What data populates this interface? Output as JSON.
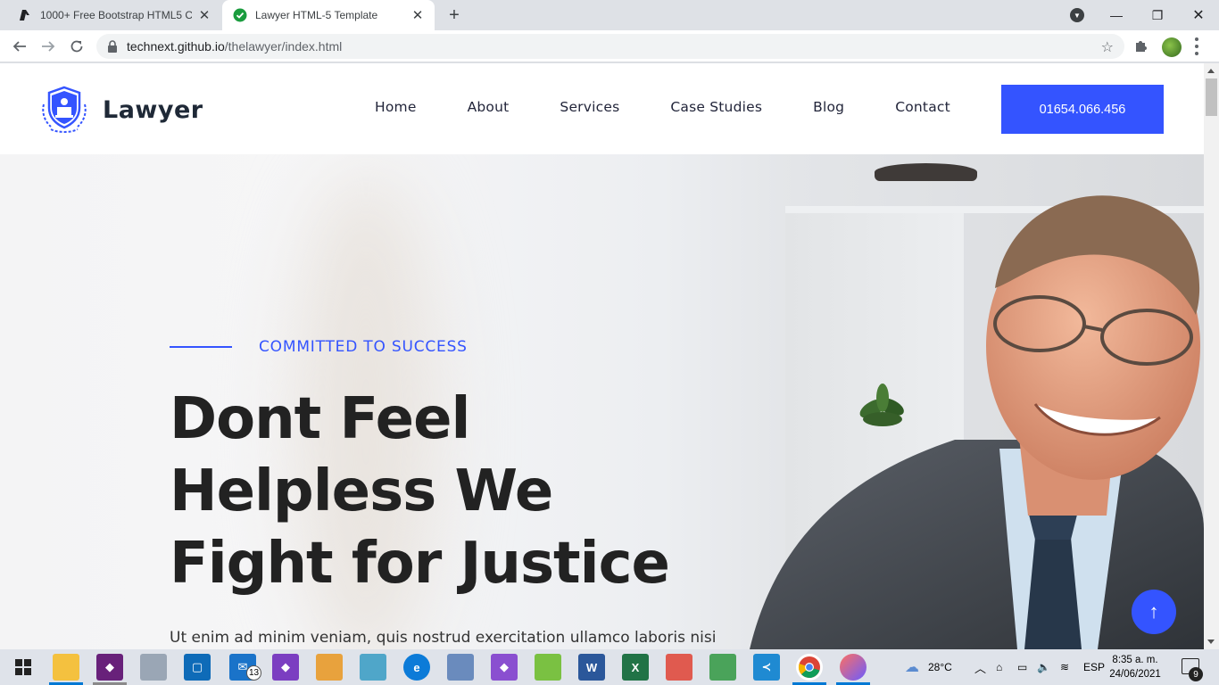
{
  "browser": {
    "tabs": [
      {
        "title": "1000+ Free Bootstrap HTML5 CS",
        "active": false
      },
      {
        "title": "Lawyer HTML-5 Template",
        "active": true
      }
    ],
    "address": {
      "host": "technext.github.io",
      "path": "/thelawyer/index.html"
    }
  },
  "site": {
    "logo_text": "Lawyer",
    "nav": [
      "Home",
      "About",
      "Services",
      "Case Studies",
      "Blog",
      "Contact"
    ],
    "phone": "01654.066.456"
  },
  "hero": {
    "kicker": "COMMITTED TO SUCCESS",
    "headline": [
      "Dont Feel",
      "Helpless We",
      "Fight for Justice"
    ],
    "lead": "Ut enim ad minim veniam, quis nostrud exercitation ullamco laboris nisi"
  },
  "taskbar": {
    "mail_badge": "13",
    "weather": "28°C",
    "language": "ESP",
    "time": "8:35 a. m.",
    "date": "24/06/2021",
    "notifications": "9"
  },
  "colors": {
    "accent": "#3454ff",
    "heading": "#222222"
  }
}
